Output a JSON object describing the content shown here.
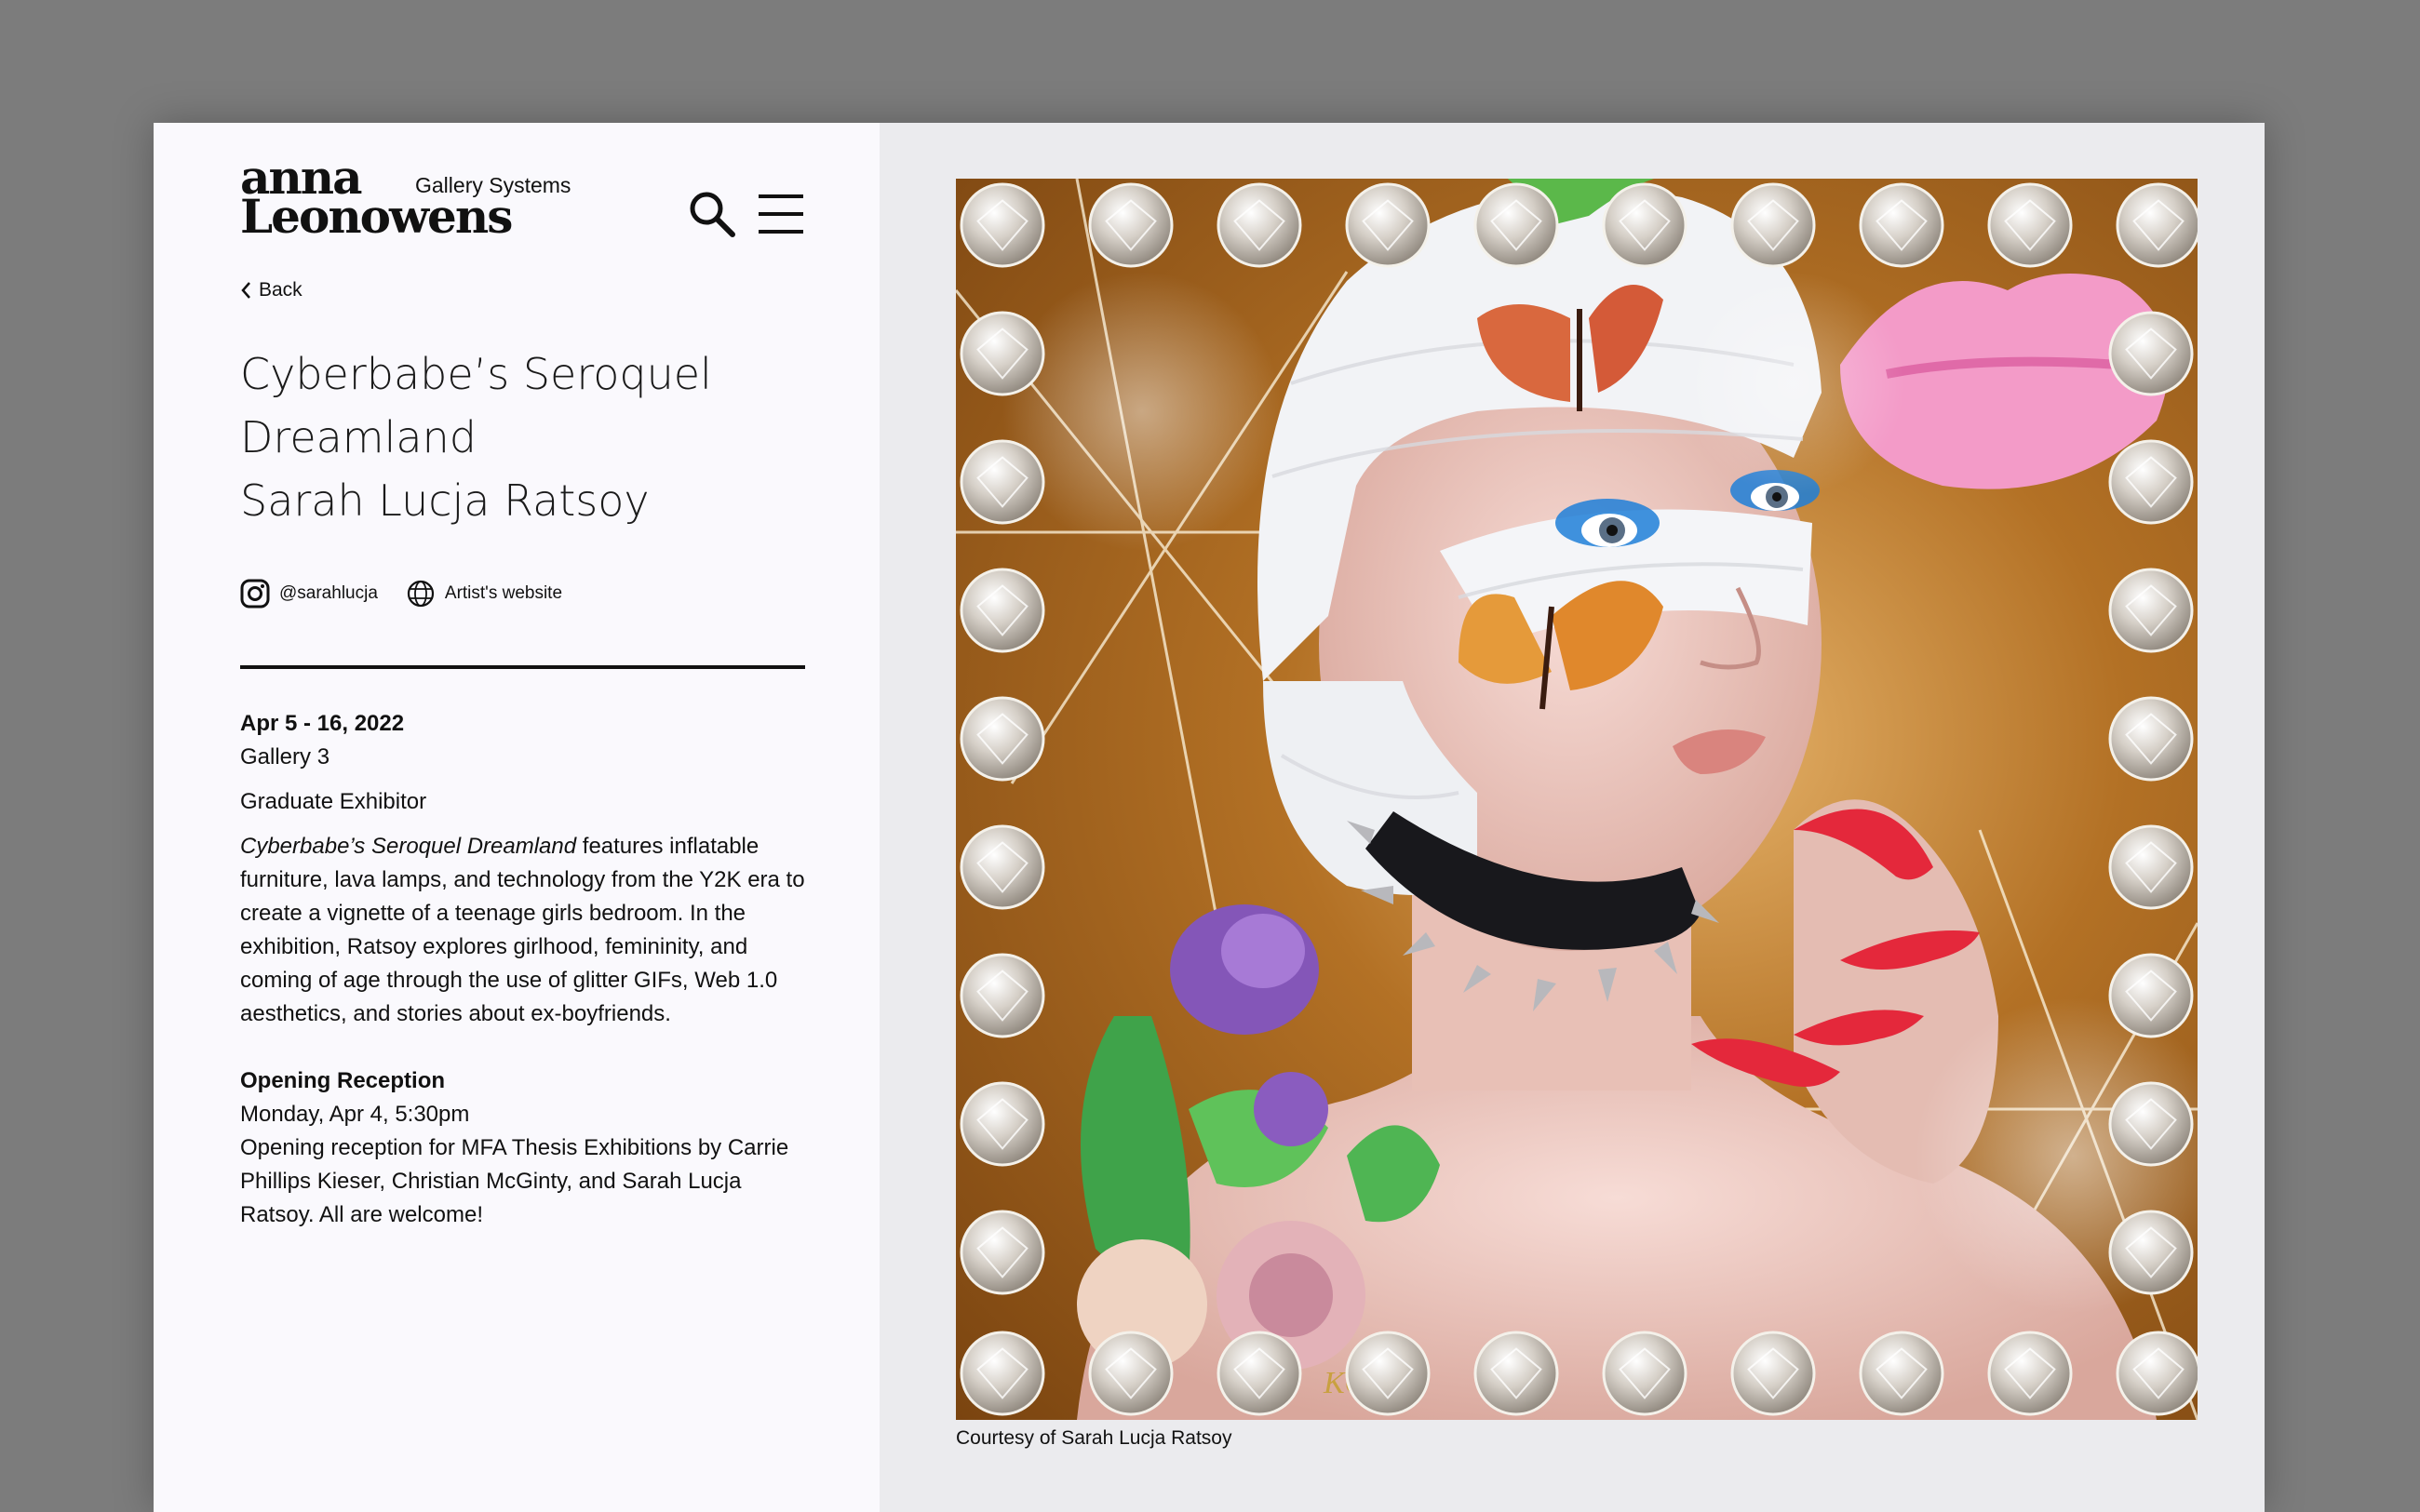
{
  "logo": {
    "line1": "anna",
    "line2": "Leonowens",
    "sub": "Gallery Systems"
  },
  "nav": {
    "back_label": "Back"
  },
  "exhibition": {
    "title_line1": "Cyberbabe’s Seroquel",
    "title_line2": "Dreamland",
    "artist": "Sarah Lucja Ratsoy",
    "instagram": "@sarahlucja",
    "website_label": "Artist's website",
    "dates": "Apr 5 - 16, 2022",
    "gallery": "Gallery 3",
    "category": "Graduate Exhibitor",
    "description_title": "Cyberbabe’s Seroquel Dreamland",
    "description_rest": " features inflatable furniture, lava lamps, and technology from the Y2K era to create a vignette of a teenage girls bedroom. In the exhibition, Ratsoy explores girlhood, femininity, and coming of age through the use of glitter GIFs, Web 1.0 aesthetics, and stories about ex-boyfriends.",
    "reception_heading": "Opening Reception",
    "reception_time": "Monday, Apr 4, 5:30pm",
    "reception_text": "Opening reception for MFA Thesis Exhibitions by Carrie Phillips Kieser, Christian McGinty, and Sarah Lucja Ratsoy. All are welcome!"
  },
  "artwork": {
    "caption": "Courtesy of Sarah Lucja Ratsoy",
    "signature": "KC"
  },
  "colors": {
    "text": "#111111",
    "left_bg": "#faf9fd",
    "right_bg": "#ebebee",
    "page_bg": "#7c7c7c",
    "lips": "#f39bc8",
    "nails": "#e4283b",
    "eyeshadow": "#1e7fd8"
  },
  "icons": {
    "search": "search-icon",
    "menu": "menu-icon",
    "back": "chevron-left-icon",
    "instagram": "instagram-icon",
    "website": "globe-icon"
  }
}
